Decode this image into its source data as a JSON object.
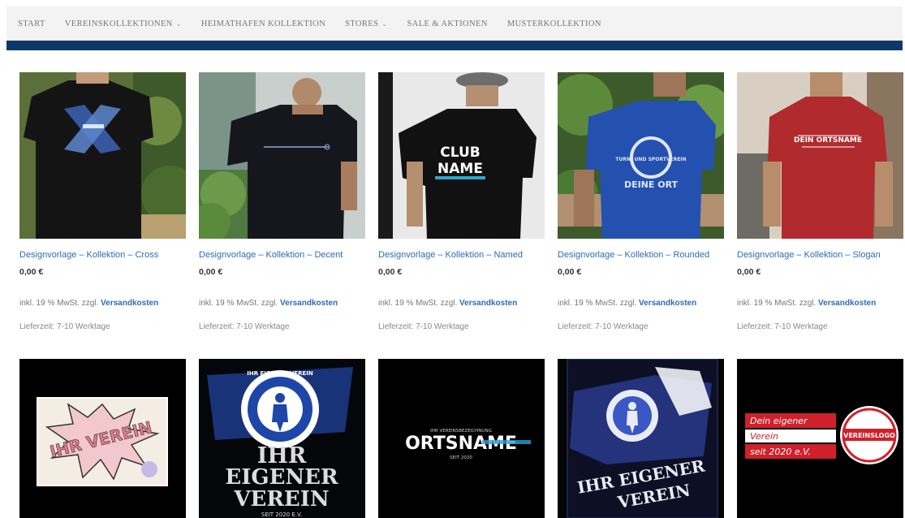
{
  "nav": {
    "items": [
      {
        "label": "START",
        "caret": false
      },
      {
        "label": "VEREINSKOLLEKTIONEN",
        "caret": true
      },
      {
        "label": "HEIMATHAFEN KOLLEKTION",
        "caret": false
      },
      {
        "label": "STORES",
        "caret": true
      },
      {
        "label": "SALE & AKTIONEN",
        "caret": false
      },
      {
        "label": "MUSTERKOLLEKTION",
        "caret": false
      }
    ],
    "caret_glyph": "⌄",
    "bar_color": "#0e3869"
  },
  "products": [
    {
      "title": "Designvorlage – Kollektion – Cross",
      "price": "0,00 €",
      "tax_prefix": "inkl. 19 % MwSt. zzgl.",
      "tax_link": "Versandkosten",
      "delivery": "Lieferzeit: 7-10 Werktage"
    },
    {
      "title": "Designvorlage – Kollektion – Decent",
      "price": "0,00 €",
      "tax_prefix": "inkl. 19 % MwSt. zzgl.",
      "tax_link": "Versandkosten",
      "delivery": "Lieferzeit: 7-10 Werktage"
    },
    {
      "title": "Designvorlage – Kollektion – Named",
      "price": "0,00 €",
      "tax_prefix": "inkl. 19 % MwSt. zzgl.",
      "tax_link": "Versandkosten",
      "delivery": "Lieferzeit: 7-10 Werktage"
    },
    {
      "title": "Designvorlage – Kollektion – Rounded",
      "price": "0,00 €",
      "tax_prefix": "inkl. 19 % MwSt. zzgl.",
      "tax_link": "Versandkosten",
      "delivery": "Lieferzeit: 7-10 Werktage"
    },
    {
      "title": "Designvorlage – Kollektion – Slogan",
      "price": "0,00 €",
      "tax_prefix": "inkl. 19 % MwSt. zzgl.",
      "tax_link": "Versandkosten",
      "delivery": "Lieferzeit: 7-10 Werktage"
    }
  ],
  "shirt_prints": {
    "named_line1": "CLUB",
    "named_line2": "NAME",
    "rounded_arc": "TURN- UND SPORTVEREIN",
    "rounded_bottom": "DEINE ORT",
    "slogan_text": "DEIN ORTSNAME"
  },
  "designs": {
    "verein_comic": "IHR VEREIN",
    "eigener_ring": "IHR EIGENER VEREIN",
    "eigener_line1": "IHR",
    "eigener_line2": "EIGENER",
    "eigener_line3": "VEREIN",
    "eigener_since": "SEIT 2020 E.V.",
    "ortsname_top": "IHR VEREINSBEZEICHNUNG",
    "ortsname_main": "ORTSNAME",
    "ortsname_since": "SEIT 2020",
    "splash_line1": "IHR EIGENER",
    "splash_line2": "VEREIN",
    "logo_line1": "Dein eigener",
    "logo_line2": "Verein",
    "logo_line3": "seit 2020 e.V.",
    "logo_badge": "VEREINSLOGO"
  },
  "colors": {
    "link": "#2e6bb5",
    "accent_red": "#d0202a"
  }
}
